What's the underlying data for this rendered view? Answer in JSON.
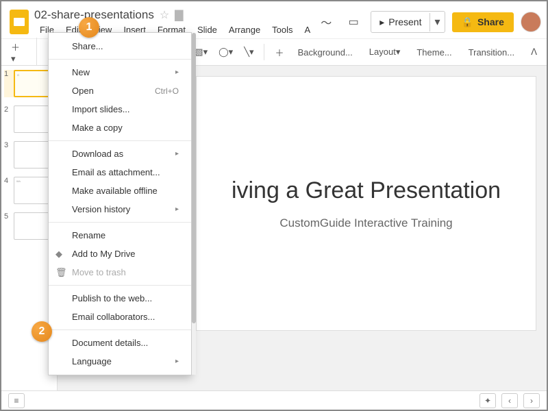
{
  "doc": {
    "title": "02-share-presentations"
  },
  "menubar": [
    "File",
    "Edit",
    "View",
    "Insert",
    "Format",
    "Slide",
    "Arrange",
    "Tools",
    "A"
  ],
  "header": {
    "present": "Present",
    "share": "Share"
  },
  "toolbar": {
    "background": "Background...",
    "layout": "Layout",
    "theme": "Theme...",
    "transition": "Transition..."
  },
  "thumbs": [
    {
      "num": "1",
      "selected": true
    },
    {
      "num": "2",
      "selected": false
    },
    {
      "num": "3",
      "selected": false
    },
    {
      "num": "4",
      "selected": false
    },
    {
      "num": "5",
      "selected": false
    }
  ],
  "slide": {
    "title": "iving a Great Presentation",
    "subtitle": "CustomGuide Interactive Training"
  },
  "dropdown": {
    "share": "Share...",
    "new": "New",
    "open": "Open",
    "open_shortcut": "Ctrl+O",
    "import": "Import slides...",
    "copy": "Make a copy",
    "download": "Download as",
    "email_attach": "Email as attachment...",
    "offline": "Make available offline",
    "version": "Version history",
    "rename": "Rename",
    "add_drive": "Add to My Drive",
    "trash": "Move to trash",
    "publish": "Publish to the web...",
    "email_collab": "Email collaborators...",
    "doc_details": "Document details...",
    "language": "Language"
  },
  "callouts": {
    "c1": "1",
    "c2": "2"
  }
}
